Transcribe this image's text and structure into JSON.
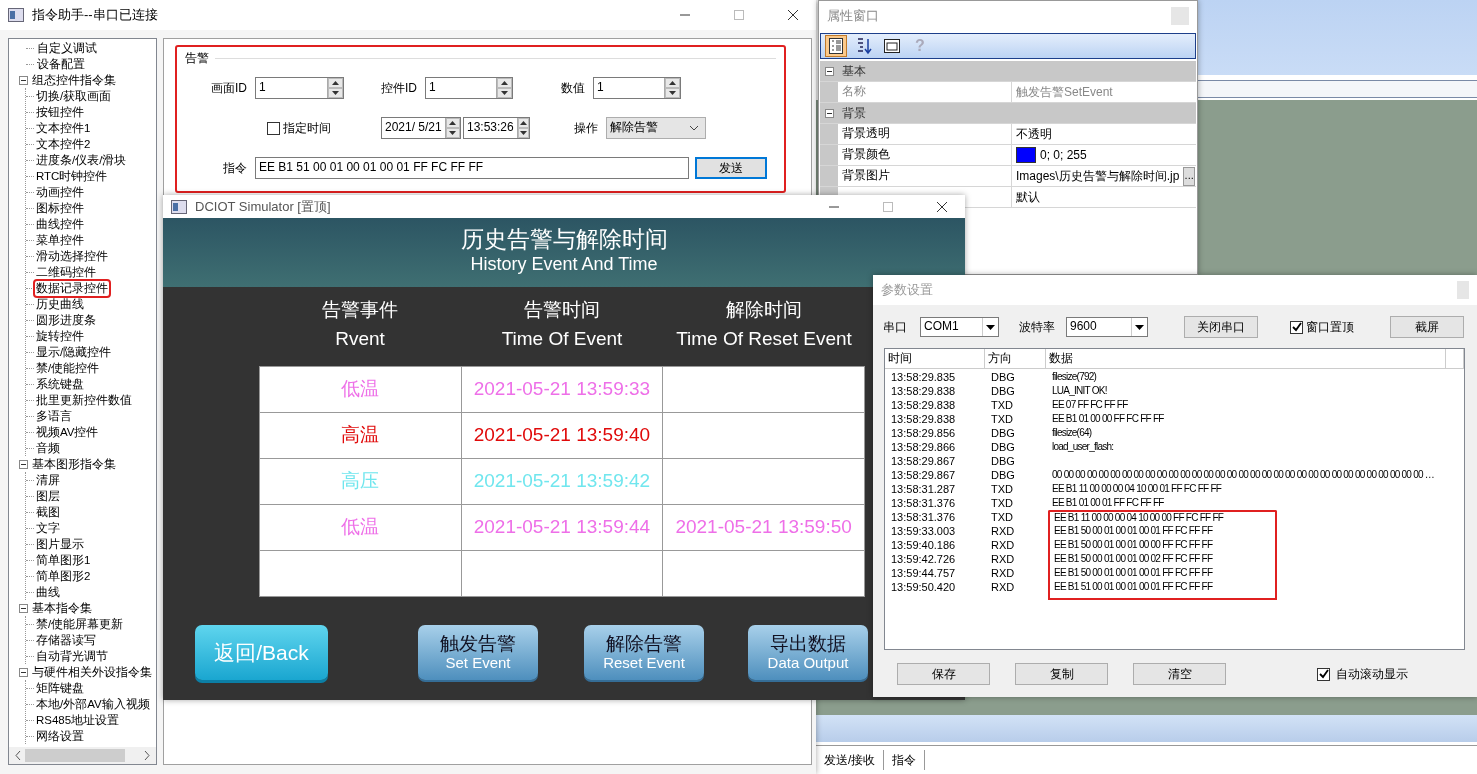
{
  "main_window": {
    "title": "指令助手--串口已连接",
    "tree": [
      {
        "label": "自定义调试"
      },
      {
        "label": "设备配置"
      },
      {
        "label": "组态控件指令集",
        "expanded": true,
        "children": [
          {
            "label": "切换/获取画面"
          },
          {
            "label": "按钮控件"
          },
          {
            "label": "文本控件1"
          },
          {
            "label": "文本控件2"
          },
          {
            "label": "进度条/仪表/滑块"
          },
          {
            "label": "RTC时钟控件"
          },
          {
            "label": "动画控件"
          },
          {
            "label": "图标控件"
          },
          {
            "label": "曲线控件"
          },
          {
            "label": "菜单控件"
          },
          {
            "label": "滑动选择控件"
          },
          {
            "label": "二维码控件"
          },
          {
            "label": "数据记录控件",
            "highlighted": true
          },
          {
            "label": "历史曲线"
          },
          {
            "label": "圆形进度条"
          },
          {
            "label": "旋转控件"
          },
          {
            "label": "显示/隐藏控件"
          },
          {
            "label": "禁/使能控件"
          },
          {
            "label": "系统键盘"
          },
          {
            "label": "批里更新控件数值"
          },
          {
            "label": "多语言"
          },
          {
            "label": "视频AV控件"
          },
          {
            "label": "音频"
          }
        ]
      },
      {
        "label": "基本图形指令集",
        "expanded": true,
        "children": [
          {
            "label": "清屏"
          },
          {
            "label": "图层"
          },
          {
            "label": "截图"
          },
          {
            "label": "文字"
          },
          {
            "label": "图片显示"
          },
          {
            "label": "简单图形1"
          },
          {
            "label": "简单图形2"
          },
          {
            "label": "曲线"
          }
        ]
      },
      {
        "label": "基本指令集",
        "expanded": true,
        "children": [
          {
            "label": "禁/使能屏幕更新"
          },
          {
            "label": "存储器读写"
          },
          {
            "label": "自动背光调节"
          }
        ]
      },
      {
        "label": "与硬件相关外设指令集",
        "expanded": true,
        "children": [
          {
            "label": "矩阵键盘"
          },
          {
            "label": "本地/外部AV输入视频"
          },
          {
            "label": "RS485地址设置"
          },
          {
            "label": "网络设置"
          }
        ]
      }
    ],
    "alarm_form": {
      "title": "告警",
      "highlighted": true,
      "screen_id": {
        "label": "画面ID",
        "value": "1"
      },
      "control_id": {
        "label": "控件ID",
        "value": "1"
      },
      "number": {
        "label": "数值",
        "value": "1"
      },
      "specify_time": {
        "label": "指定时间",
        "checked": false
      },
      "date": "2021/  5/21",
      "time": "13:53:26",
      "operation": {
        "label": "操作",
        "value": "解除告警"
      },
      "command": {
        "label": "指令",
        "value": "EE B1 51 00 01 00 01 00 01 FF FC FF FF"
      },
      "send_button": "发送"
    }
  },
  "property_window": {
    "title": "属性窗口",
    "toolbar": [
      {
        "kind": "categorized",
        "selected": true
      },
      {
        "kind": "alphabetical",
        "selected": false
      },
      {
        "kind": "pages",
        "selected": false
      },
      {
        "kind": "help",
        "selected": false,
        "glyph": "?"
      }
    ],
    "categories": [
      {
        "name": "基本",
        "expanded": true,
        "properties": [
          {
            "label": "名称",
            "value": "触发告警SetEvent",
            "disabled": true
          }
        ]
      },
      {
        "name": "背景",
        "expanded": true,
        "properties": [
          {
            "label": "背景透明",
            "value": "不透明"
          },
          {
            "label": "背景颜色",
            "value": "0; 0; 255",
            "color": "#0000ff"
          },
          {
            "label": "背景图片",
            "value": "Images\\历史告警与解除时间.jp",
            "kind": "file",
            "button": "..."
          },
          {
            "value": "默认"
          }
        ]
      }
    ]
  },
  "simulator": {
    "title": "DCIOT Simulator [置顶]",
    "heading": "历史告警与解除时间",
    "subheading": "History Event And Time",
    "columns": [
      {
        "title": "告警事件",
        "subtitle": "Rvent"
      },
      {
        "title": "告警时间",
        "subtitle": "Time Of Event"
      },
      {
        "title": "解除时间",
        "subtitle": "Time Of Reset Event"
      }
    ],
    "rows": [
      {
        "kind": "event",
        "event": "低温",
        "event_time": "2021-05-21 13:59:33",
        "color": "#ee6fe8"
      },
      {
        "kind": "event",
        "event": "高温",
        "event_time": "2021-05-21 13:59:40",
        "color": "#e00a0a"
      },
      {
        "kind": "event",
        "event": "高压",
        "event_time": "2021-05-21 13:59:42",
        "color": "#70e6ee"
      },
      {
        "kind": "event",
        "event": "低温",
        "event_time": "2021-05-21 13:59:44",
        "reset_time": "2021-05-21 13:59:50",
        "color": "#ee6fe8"
      },
      {
        "kind": "blank"
      }
    ],
    "buttons": [
      {
        "kind": "accent",
        "lines": [
          "返回/Back"
        ]
      },
      {
        "kind": "normal",
        "lines": [
          "触发告警",
          "Set Event"
        ]
      },
      {
        "kind": "normal",
        "lines": [
          "解除告警",
          "Reset Event"
        ]
      },
      {
        "kind": "normal",
        "lines": [
          "导出数据",
          "Data Output"
        ]
      }
    ]
  },
  "param_window": {
    "title": "参数设置",
    "port": {
      "label": "串口",
      "value": "COM1"
    },
    "baud": {
      "label": "波特率",
      "value": "9600"
    },
    "close_port_button": "关闭串口",
    "on_top": {
      "label": "窗口置顶",
      "checked": true
    },
    "screenshot_button": "截屏",
    "log_columns": [
      "时间",
      "方向",
      "数据"
    ],
    "log": [
      {
        "time": "13:58:29.835",
        "direction": "DBG",
        "data": "filesize(792)",
        "highlighted": false
      },
      {
        "time": "13:58:29.838",
        "direction": "DBG",
        "data": "LUA_INIT OK!",
        "highlighted": false
      },
      {
        "time": "13:58:29.838",
        "direction": "TXD",
        "data": "EE 07 FF FC FF FF",
        "highlighted": false
      },
      {
        "time": "13:58:29.838",
        "direction": "TXD",
        "data": "EE B1 01 00 00 FF FC FF FF",
        "highlighted": false
      },
      {
        "time": "13:58:29.856",
        "direction": "DBG",
        "data": "filesize(64)",
        "highlighted": false
      },
      {
        "time": "13:58:29.866",
        "direction": "DBG",
        "data": "load_user_flash:",
        "highlighted": false
      },
      {
        "time": "13:58:29.867",
        "direction": "DBG",
        "highlighted": false
      },
      {
        "time": "13:58:29.867",
        "direction": "DBG",
        "data": "00 00 00 00 00 00 00 00 00 00 00 00 00 00 00 00 00 00 00 00 00 00 00 00 00 00 00 00 00 00 00 00 …",
        "highlighted": false
      },
      {
        "time": "13:58:31.287",
        "direction": "TXD",
        "data": "EE B1 11 00 00 00 04 10 00 01 FF FC FF FF",
        "highlighted": false
      },
      {
        "time": "13:58:31.376",
        "direction": "TXD",
        "data": "EE B1 01 00 01 FF FC FF FF",
        "highlighted": false
      },
      {
        "time": "13:58:31.376",
        "direction": "TXD",
        "data": "EE B1 11 00 00 00 04 10 00 00 FF FC FF FF",
        "highlighted": true
      },
      {
        "time": "13:59:33.003",
        "direction": "RXD",
        "data": "EE B1 50 00 01 00 01 00 01 FF FC FF FF",
        "highlighted": true
      },
      {
        "time": "13:59:40.186",
        "direction": "RXD",
        "data": "EE B1 50 00 01 00 01 00 00 FF FC FF FF",
        "highlighted": true
      },
      {
        "time": "13:59:42.726",
        "direction": "RXD",
        "data": "EE B1 50 00 01 00 01 00 02 FF FC FF FF",
        "highlighted": true
      },
      {
        "time": "13:59:44.757",
        "direction": "RXD",
        "data": "EE B1 50 00 01 00 01 00 01 FF FC FF FF",
        "highlighted": true
      },
      {
        "time": "13:59:50.420",
        "direction": "RXD",
        "data": "EE B1 51 00 01 00 01 00 01 FF FC FF FF",
        "highlighted": true
      }
    ],
    "buttons": [
      "保存",
      "复制",
      "清空"
    ],
    "auto_scroll": {
      "label": "自动滚动显示",
      "checked": true
    }
  },
  "bottom_tabs": [
    "发送/接收",
    "指令"
  ]
}
